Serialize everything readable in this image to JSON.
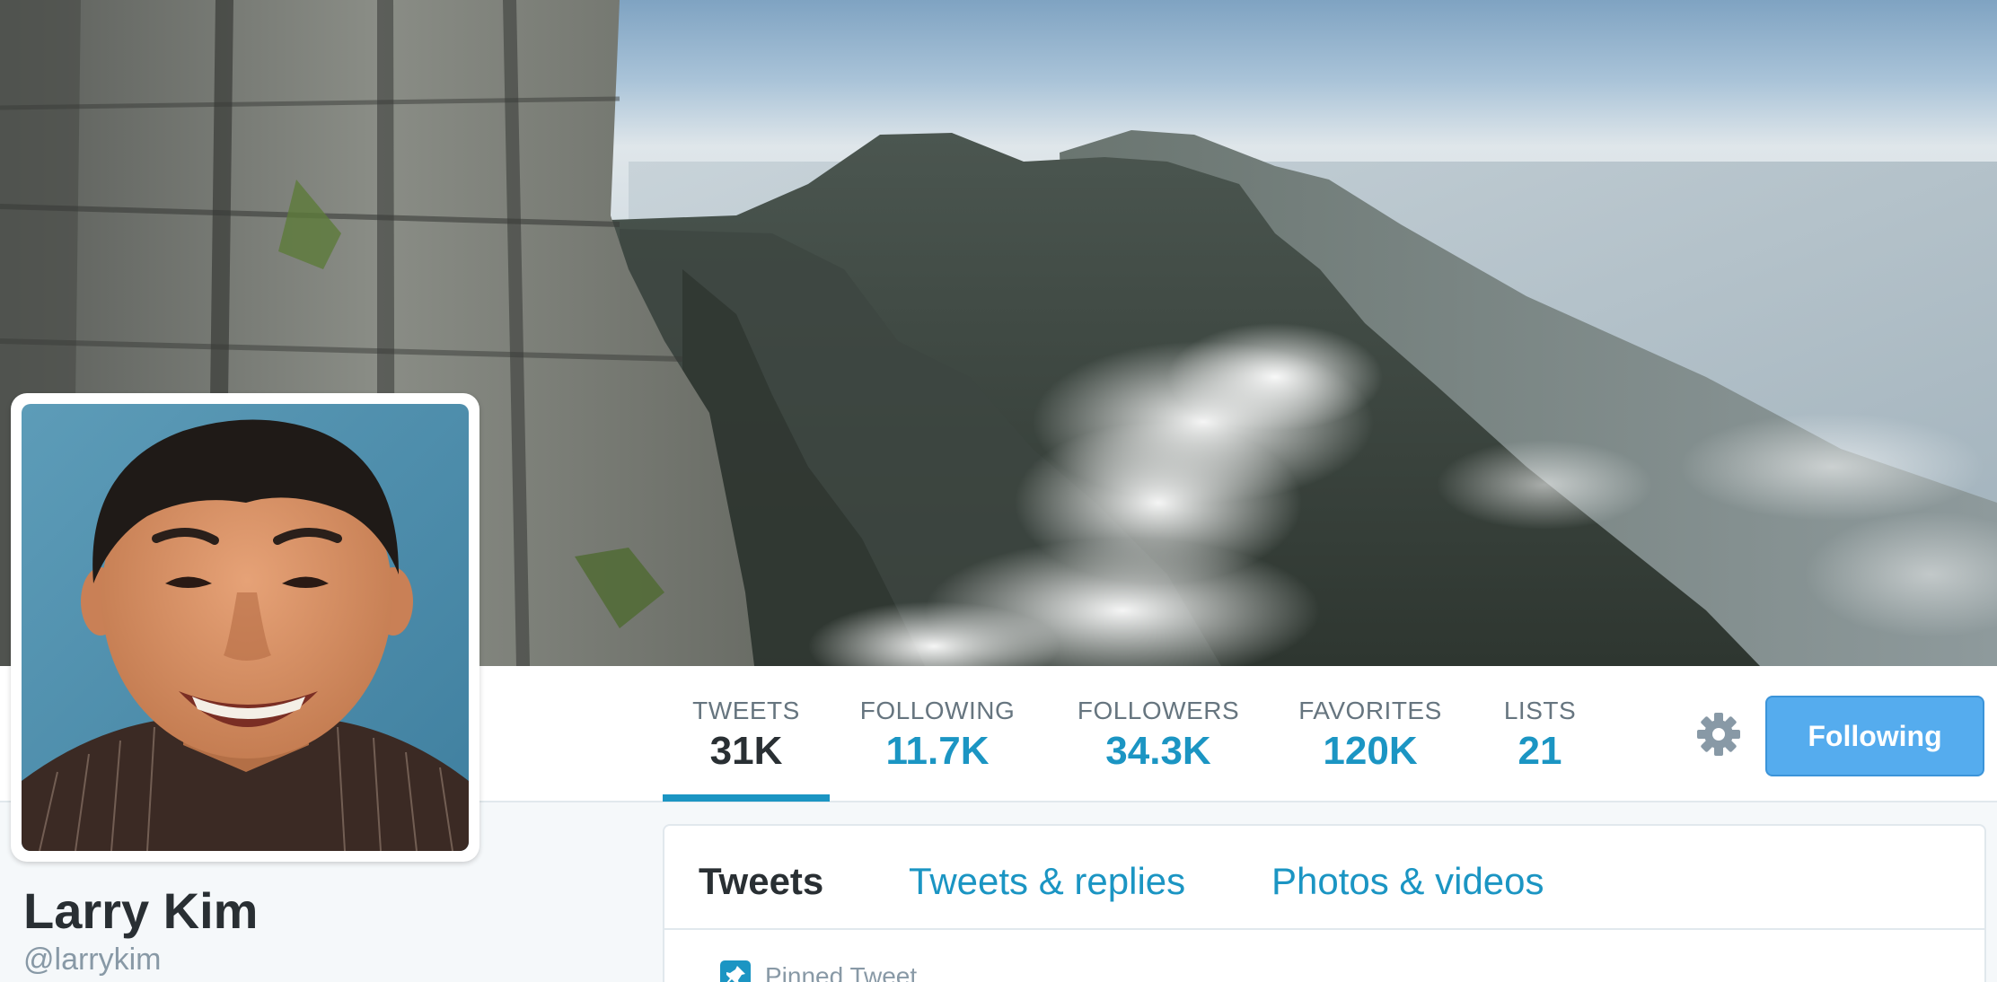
{
  "profile": {
    "name": "Larry Kim",
    "handle": "@larrykim"
  },
  "stats": [
    {
      "label": "TWEETS",
      "value": "31K",
      "active": true
    },
    {
      "label": "FOLLOWING",
      "value": "11.7K",
      "active": false
    },
    {
      "label": "FOLLOWERS",
      "value": "34.3K",
      "active": false
    },
    {
      "label": "FAVORITES",
      "value": "120K",
      "active": false
    },
    {
      "label": "LISTS",
      "value": "21",
      "active": false
    }
  ],
  "actions": {
    "settings_icon": "gear-icon",
    "follow_label": "Following"
  },
  "timeline": {
    "tabs": [
      {
        "label": "Tweets",
        "active": true
      },
      {
        "label": "Tweets & replies",
        "active": false
      },
      {
        "label": "Photos & videos",
        "active": false
      }
    ],
    "pinned_label": "Pinned Tweet",
    "pinned_icon": "pin-icon"
  },
  "colors": {
    "accent": "#1b95c3",
    "button": "#55acee",
    "text_dark": "#292f33",
    "text_muted": "#66757f",
    "background": "#f5f8fa"
  }
}
